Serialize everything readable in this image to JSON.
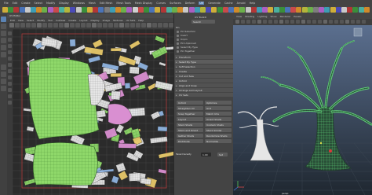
{
  "menubar": {
    "items": [
      "File",
      "Edit",
      "Create",
      "Select",
      "Modify",
      "Display",
      "Windows",
      "Mesh",
      "Edit Mesh",
      "Mesh Tools",
      "Mesh Display",
      "Curves",
      "Surfaces",
      "Deform",
      "UV",
      "Generate",
      "Cache",
      "Arnold",
      "Help"
    ],
    "active_index": 14
  },
  "shelf": {
    "icons": [
      "#cfae3a",
      "#3a8f3a",
      "#b23636",
      "#4a73b8",
      "#c9c9c9",
      "#3e9db5",
      "#d08a2a",
      "#6bb04a",
      "#aa5fc2",
      "#c94a4a",
      "#4ab0a0",
      "#b5b53a",
      "#4a4ab8",
      "#c4c4c4",
      "#3a8f3a",
      "#cfae3a",
      "#b23636",
      "#4a73b8",
      "#7d7d7d",
      "#3e9db5",
      "#d08a2a",
      "#6bb04a",
      "#aa5fc2",
      "#cfcfcf",
      "#c94a4a",
      "#3a8f3a",
      "#4a73b8",
      "#cfae3a",
      "#b23636",
      "#4ab0a0",
      "#6bb04a",
      "#d08a2a",
      "#c9c9c9",
      "#aa5fc2",
      "#3e9db5",
      "#b5b53a",
      "#4a4ab8",
      "#cfae3a",
      "#3a8f3a",
      "#c94a4a",
      "#4a73b8",
      "#d08a2a",
      "#6bb04a",
      "#c4c4c4",
      "#b23636",
      "#3e9db5",
      "#aa5fc2",
      "#cfae3a",
      "#4ab0a0",
      "#3a8f3a",
      "#4a73b8",
      "#c94a4a",
      "#d08a2a",
      "#b5b53a",
      "#6bb04a",
      "#7d7d7d",
      "#aa5fc2",
      "#3e9db5",
      "#cfae3a",
      "#4a4ab8",
      "#c9c9c9",
      "#b23636",
      "#3a8f3a",
      "#4ab0a0",
      "#d08a2a"
    ]
  },
  "uv_editor": {
    "title": "UV Editor",
    "menus": [
      "Edit",
      "View",
      "Select",
      "Modify",
      "Tool",
      "Cut/Sew",
      "Create",
      "Layout",
      "Display",
      "Image",
      "Textures",
      "UV Sets",
      "Help"
    ],
    "colors": {
      "shell_green": "#8fd86a",
      "shell_white": "#e6e6e6",
      "shell_pink": "#d98fd1",
      "shell_yellow": "#e7c86a",
      "shell_blue": "#8fb3e0",
      "grid_line": "#4a4a4a",
      "border": "#b13b3b"
    }
  },
  "uv_toolkit": {
    "title": "UV Toolkit",
    "subtitle": "Search",
    "pin_section": "Pin",
    "items": [
      "Pin Selection",
      "Invert",
      "Unpin",
      "Pin Unpinned",
      "Select By Type",
      "Pin Together"
    ],
    "sections": [
      "Transform",
      "Select By Type",
      "Soft Selection",
      "Create",
      "Cut and Sew",
      "Unfold",
      "Align and Snap",
      "Arrange and Layout",
      "UV Sets"
    ],
    "buttons": [
      "Unfold",
      "Optimize",
      "Straighten UV",
      "Grid",
      "Snap Together",
      "Match UVs",
      "Layout",
      "Orient Shells",
      "Stack Shells",
      "Unstack Shells",
      "Stack and Orient",
      "Stack Similar",
      "Gather Shells",
      "Randomize Shells",
      "Distribute",
      "Normalize"
    ],
    "density_label": "Texel Density",
    "density_value": "1.00",
    "density_button": "Set"
  },
  "viewport": {
    "menus": [
      "View",
      "Shading",
      "Lighting",
      "Show",
      "Renderer",
      "Panels"
    ],
    "camera_label": "persp",
    "colors": {
      "background_top": "#5b6f8f",
      "background_bottom": "#1f2730",
      "grid": "#3f4a55",
      "mesh_green": "#62d37a",
      "mesh_dark": "#2a5038",
      "mesh_white": "#e6e6e6",
      "selected": "#d93a3a"
    }
  }
}
